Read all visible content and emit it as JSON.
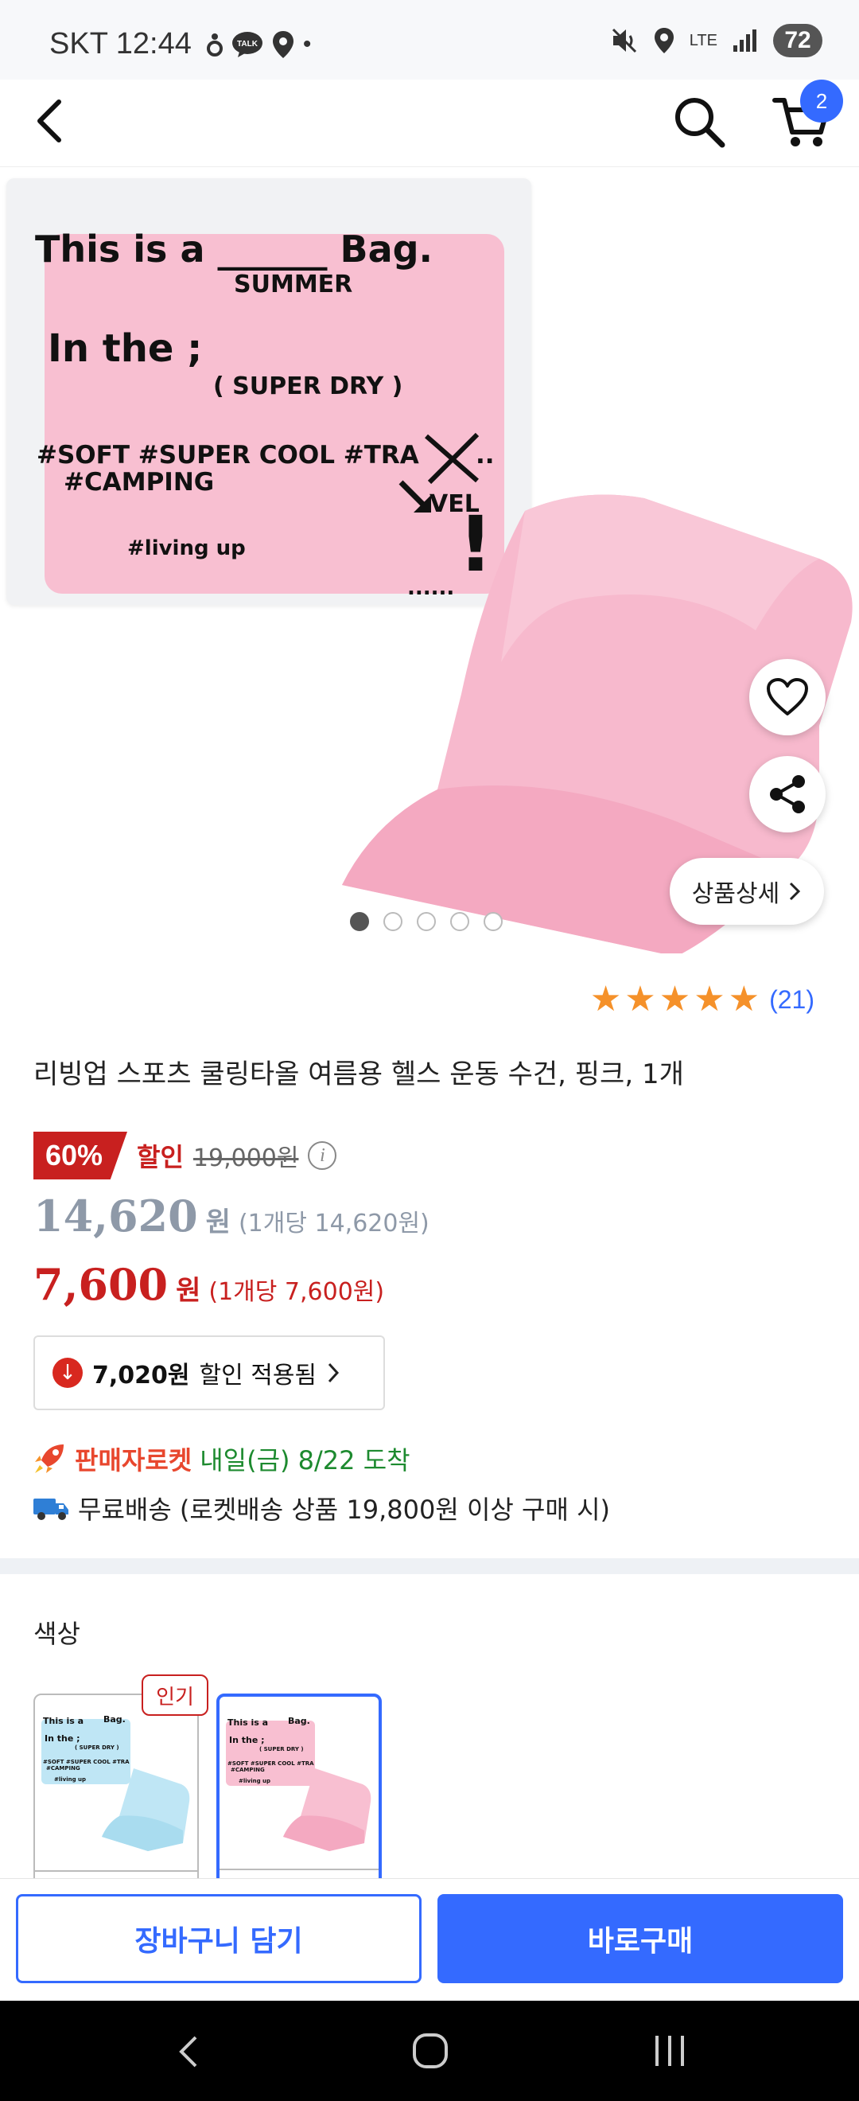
{
  "status_bar": {
    "carrier_time": "SKT 12:44",
    "network": "LTE",
    "battery": "72",
    "icons": [
      "mute-icon",
      "location-icon",
      "signal-icon"
    ]
  },
  "nav": {
    "back_icon": "back-arrow-icon",
    "search_icon": "search-icon",
    "cart_icon": "cart-icon",
    "cart_count": "2"
  },
  "hero": {
    "bag_text": {
      "line1": "This is a ______ Bag.",
      "line1_fill": "SUMMER",
      "line2": "In the ;",
      "line3": "( SUPER DRY )",
      "line4": "#SOFT #SUPER COOL #TRA",
      "line4_end": "..",
      "crossed": "VEL",
      "line5": "#CAMPING",
      "line6": "#living up",
      "dots": "......",
      "bang": "!"
    },
    "detail_button": "상품상세",
    "slide_count": 5,
    "active_slide": 0,
    "colors": {
      "bag": "#f1f2f4",
      "towel_pink": "#f8bfd1"
    }
  },
  "rating": {
    "stars": 5,
    "count": "(21)"
  },
  "product": {
    "title": "리빙업 스포츠 쿨링타올 여름용 헬스 운동 수건, 핑크, 1개"
  },
  "pricing": {
    "discount_pct": "60%",
    "discount_label": "할인",
    "original_price": "19,000원",
    "member_price": "14,620",
    "member_unit": "원",
    "member_per": "(1개당 14,620원)",
    "final_price": "7,600",
    "final_unit": "원",
    "final_per": "(1개당 7,600원)",
    "coupon_amount": "7,020원",
    "coupon_text": "할인 적용됨",
    "colors": {
      "sale_red": "#c8201f",
      "member_gray": "#8e99a8",
      "accent_blue": "#346aff"
    }
  },
  "delivery": {
    "rocket_label": "판매자로켓",
    "arrival": "내일(금) 8/22 도착",
    "free_shipping": "무료배송 (로켓배송 상품 19,800원 이상 구매 시)"
  },
  "options": {
    "label": "색상",
    "hot_badge": "인기",
    "items": [
      {
        "name": "blue",
        "color": "#bfe6f5",
        "selected": false
      },
      {
        "name": "pink",
        "color": "#f8bfd1",
        "selected": true
      }
    ],
    "thumb_text": {
      "line1": "This is a",
      "line1_end": "Bag.",
      "line2": "In the ;",
      "line3": "( SUPER DRY )",
      "line4": "#SOFT #SUPER COOL #TRA",
      "line5": "#CAMPING",
      "line6": "#living up"
    }
  },
  "actions": {
    "add_to_cart": "장바구니 담기",
    "buy_now": "바로구매"
  },
  "system_nav": [
    "back-icon",
    "home-icon",
    "recents-icon"
  ]
}
